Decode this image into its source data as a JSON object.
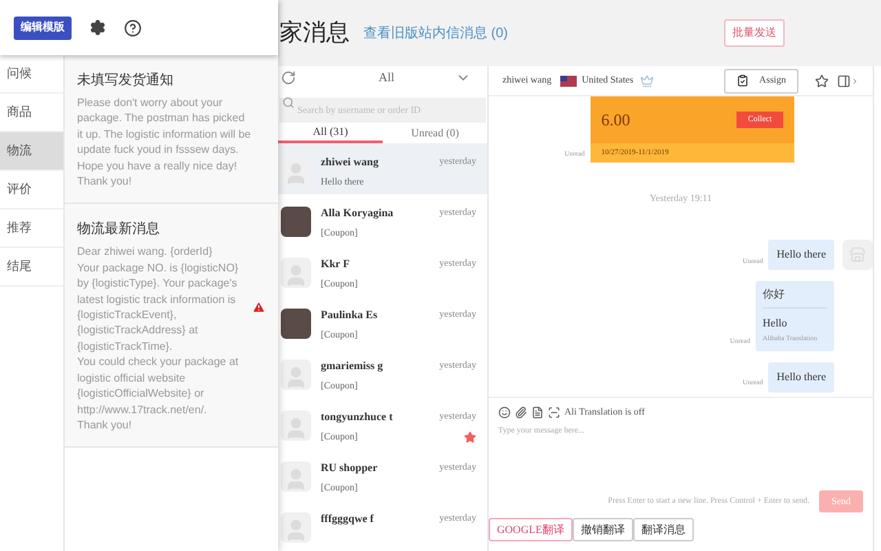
{
  "toolbar": {
    "edit_button": "编辑模版"
  },
  "categories": [
    {
      "label": "问候",
      "selected": false
    },
    {
      "label": "商品",
      "selected": false
    },
    {
      "label": "物流",
      "selected": true
    },
    {
      "label": "评价",
      "selected": false
    },
    {
      "label": "推荐",
      "selected": false
    },
    {
      "label": "结尾",
      "selected": false
    }
  ],
  "templates": [
    {
      "title": "未填写发货通知",
      "body": "Please don't worry about your package. The postman has picked it up. The logistic information will be update fuck youd in fsssew days. Hope you have a really nice day!\nThank you!",
      "warning": false
    },
    {
      "title": "物流最新消息",
      "body": "Dear zhiwei wang.  {orderId}\nYour package NO. is {logisticNO} by {logisticType}. Your package's latest logistic track information is {logisticTrackEvent}, {logisticTrackAddress} at {logisticTrackTime}.\n You could check your package at logistic official website {logisticOfficialWebsite} or http://www.17track.net/en/.\nThank you!",
      "warning": true
    }
  ],
  "header": {
    "title": "家消息",
    "link": "查看旧版站内信消息 (0)",
    "bulk_button": "批量发送"
  },
  "conversations": {
    "filter": "All",
    "search_placeholder": "Search by username or order ID",
    "tabs": [
      {
        "label": "All (31)",
        "selected": true
      },
      {
        "label": "Unread (0)",
        "selected": false
      }
    ],
    "items": [
      {
        "name": "zhiwei wang",
        "preview": "Hello there",
        "time": "yesterday",
        "selected": true,
        "starred": false,
        "photo": false
      },
      {
        "name": "Alla Koryagina",
        "preview": "[Coupon]",
        "time": "yesterday",
        "selected": false,
        "starred": false,
        "photo": true
      },
      {
        "name": "Kkr F",
        "preview": "[Coupon]",
        "time": "yesterday",
        "selected": false,
        "starred": false,
        "photo": false
      },
      {
        "name": "Paulinka Es",
        "preview": "[Coupon]",
        "time": "yesterday",
        "selected": false,
        "starred": false,
        "photo": true
      },
      {
        "name": "gmariemiss g",
        "preview": "[Coupon]",
        "time": "yesterday",
        "selected": false,
        "starred": false,
        "photo": false
      },
      {
        "name": "tongyunzhuce t",
        "preview": "[Coupon]",
        "time": "yesterday",
        "selected": false,
        "starred": true,
        "photo": false
      },
      {
        "name": "RU shopper",
        "preview": "[Coupon]",
        "time": "yesterday",
        "selected": false,
        "starred": false,
        "photo": false
      },
      {
        "name": "fffgggqwe f",
        "time": "yesterday",
        "selected": false,
        "starred": false,
        "photo": false
      }
    ]
  },
  "chat": {
    "user": "zhiwei wang",
    "country": "United States",
    "assign": "Assign",
    "coupon": {
      "amount": "6.00",
      "collect": "Collect",
      "dates": "10/27/2019-11/1/2019",
      "status": "Unread"
    },
    "timestamp": "Yesterday 19:11",
    "messages": [
      {
        "kind": "text",
        "text": "Hello there",
        "status": "Unread",
        "avatar": true
      },
      {
        "kind": "translated",
        "original": "你好",
        "translation": "Hello",
        "source": "Alibaba Translation",
        "status": "Unread",
        "avatar": false
      },
      {
        "kind": "text",
        "text": "Hello there",
        "status": "Unread",
        "avatar": false
      }
    ],
    "translation_status": "Ali Translation is off",
    "input_placeholder": "Type your message here...",
    "hint": "Press Enter to start a new line. Press Control + Enter to send.",
    "send": "Send",
    "bottom_buttons": [
      {
        "label": "GOOGLE翻译",
        "selected": true
      },
      {
        "label": "撤销翻译",
        "selected": false
      },
      {
        "label": "翻译消息",
        "selected": false
      }
    ]
  }
}
